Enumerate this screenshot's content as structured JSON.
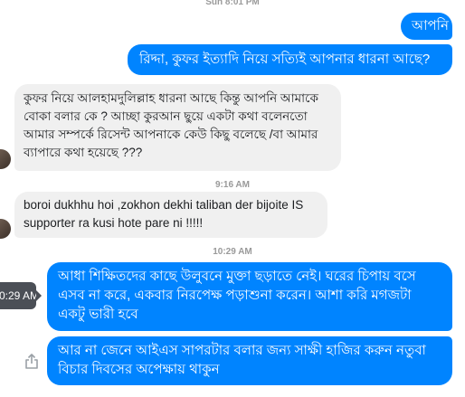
{
  "timestamps": {
    "top": "Sun 8:01 PM",
    "mid": "9:16 AM",
    "late": "10:29 AM"
  },
  "tooltip": {
    "text": "0:29 AM"
  },
  "messages": [
    {
      "text": "আপনি"
    },
    {
      "text": "রিদ্দা, কুফর ইত্যাদি নিয়ে সত্যিই আপনার ধারনা আছে?"
    },
    {
      "lines": [
        "কুফর নিয়ে আলহামদুলিল্লাহ ধারনা আছে কিন্তু আপনি আমাকে",
        "বোকা বলার কে ? আচ্ছা কুরআন ছুয়ে একটা কথা বলেনতো",
        "আমার সম্পর্কে রিসেন্ট আপনাকে কেউ কিছু বলেছে /বা আমার",
        "ব্যাপারে কথা হয়েছে ???"
      ]
    },
    {
      "lines": [
        "boroi dukhhu hoi ,zokhon dekhi taliban der bijoite IS",
        "supporter ra kusi hote pare ni !!!!!"
      ]
    },
    {
      "lines": [
        "আধা শিক্ষিতদের কাছে উলুবনে মুক্তা ছড়াতে নেই। ঘরের চিপায় বসে",
        "এসব না করে, একবার নিরপেক্ষ পড়াশুনা করেন। আশা করি মগজটা",
        "একটু ভারী হবে"
      ]
    },
    {
      "lines": [
        "আর না জেনে আইএস সাপরটার বলার জন্য সাক্ষী হাজির করুন নতুবা",
        "বিচার দিবসের অপেক্ষায় থাকুন"
      ]
    }
  ],
  "colors": {
    "outgoing_bubble": "#0084ff",
    "incoming_bubble": "#f0f0f0",
    "timestamp": "#9a9a9a",
    "tooltip_bg": "#4b4f56"
  },
  "icons": {
    "share": "share-icon",
    "avatar": "avatar"
  }
}
